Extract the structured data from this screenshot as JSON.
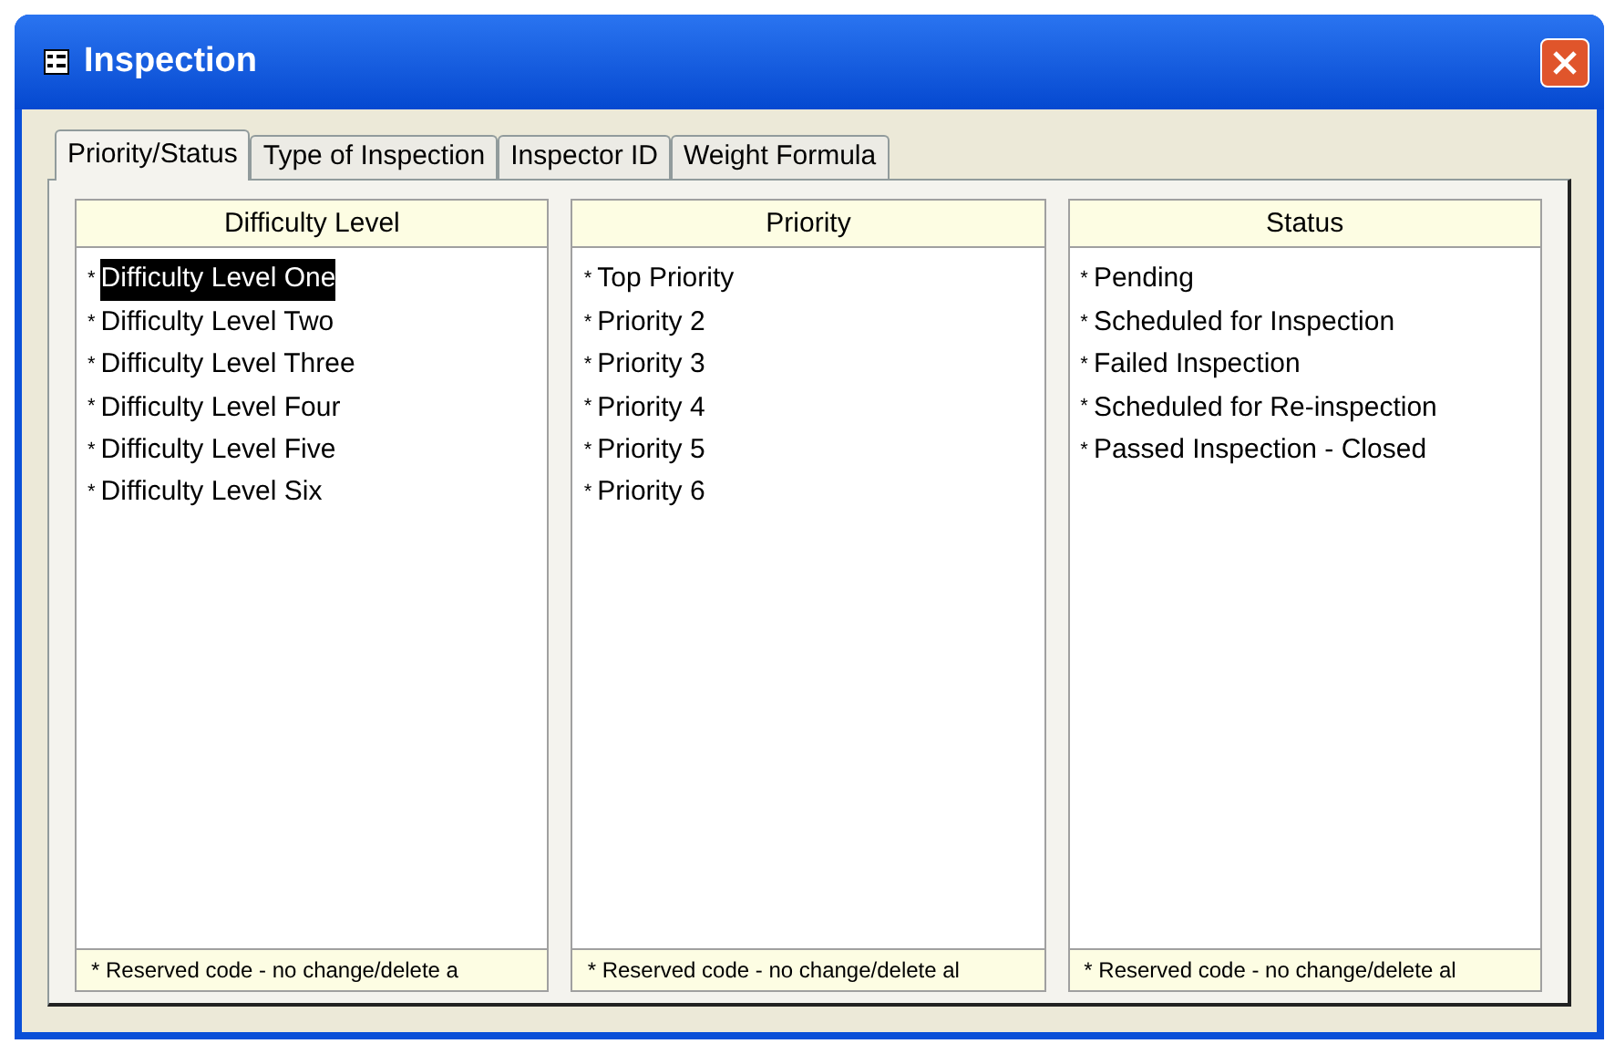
{
  "window": {
    "title": "Inspection"
  },
  "tabs": [
    {
      "label": "Priority/Status",
      "selected": true
    },
    {
      "label": "Type of Inspection",
      "selected": false
    },
    {
      "label": "Inspector ID",
      "selected": false
    },
    {
      "label": "Weight Formula",
      "selected": false
    }
  ],
  "lists": [
    {
      "header": "Difficulty Level",
      "footer": "* Reserved code - no change/delete a",
      "items": [
        {
          "mark": "*",
          "label": "Difficulty Level One",
          "selected": true
        },
        {
          "mark": "*",
          "label": "Difficulty Level Two",
          "selected": false
        },
        {
          "mark": "*",
          "label": "Difficulty Level Three",
          "selected": false
        },
        {
          "mark": "*",
          "label": "Difficulty Level Four",
          "selected": false
        },
        {
          "mark": "*",
          "label": "Difficulty Level Five",
          "selected": false
        },
        {
          "mark": "*",
          "label": "Difficulty Level Six",
          "selected": false
        }
      ]
    },
    {
      "header": "Priority",
      "footer": "* Reserved code - no change/delete al",
      "items": [
        {
          "mark": "*",
          "label": "Top Priority",
          "selected": false
        },
        {
          "mark": "*",
          "label": "Priority 2",
          "selected": false
        },
        {
          "mark": "*",
          "label": "Priority 3",
          "selected": false
        },
        {
          "mark": "*",
          "label": "Priority 4",
          "selected": false
        },
        {
          "mark": "*",
          "label": "Priority 5",
          "selected": false
        },
        {
          "mark": "*",
          "label": "Priority 6",
          "selected": false
        }
      ]
    },
    {
      "header": "Status",
      "footer": "* Reserved code - no change/delete al",
      "items": [
        {
          "mark": "*",
          "label": "Pending",
          "selected": false
        },
        {
          "mark": "*",
          "label": "Scheduled for Inspection",
          "selected": false
        },
        {
          "mark": "*",
          "label": "Failed Inspection",
          "selected": false
        },
        {
          "mark": "*",
          "label": "Scheduled for Re-inspection",
          "selected": false
        },
        {
          "mark": "*",
          "label": "Passed Inspection - Closed",
          "selected": false
        }
      ]
    }
  ]
}
